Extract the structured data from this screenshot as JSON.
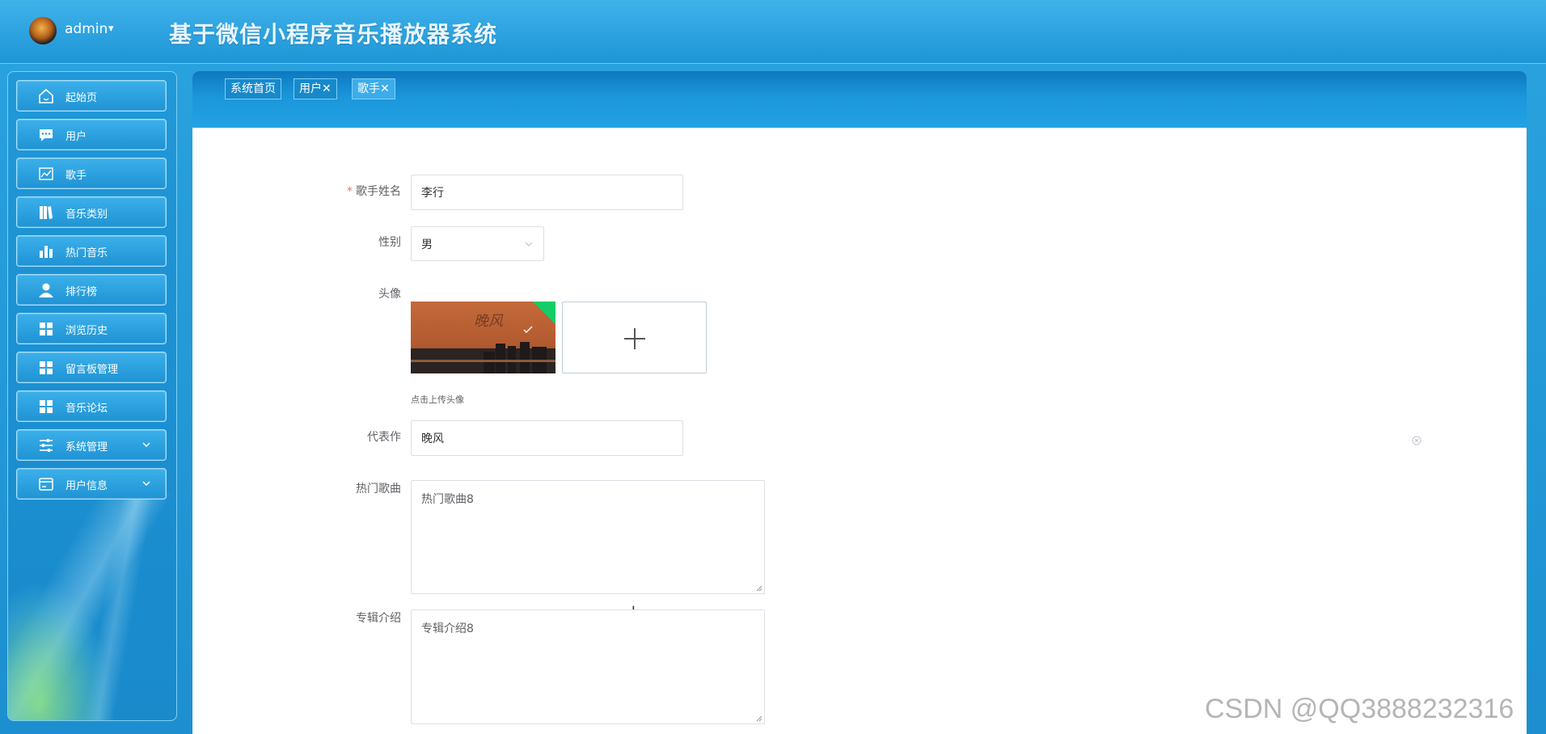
{
  "header": {
    "app_title": "基于微信小程序音乐播放器系统",
    "user": "admin",
    "user_caret": "▾"
  },
  "sidebar": {
    "items": [
      {
        "label": "起始页",
        "icon": "home-icon"
      },
      {
        "label": "用户",
        "icon": "chat-icon"
      },
      {
        "label": "歌手",
        "icon": "trend-chart-icon"
      },
      {
        "label": "音乐类别",
        "icon": "books-icon"
      },
      {
        "label": "热门音乐",
        "icon": "bar-chart-icon"
      },
      {
        "label": "排行榜",
        "icon": "person-icon"
      },
      {
        "label": "浏览历史",
        "icon": "grid-icon"
      },
      {
        "label": "留言板管理",
        "icon": "grid-icon"
      },
      {
        "label": "音乐论坛",
        "icon": "grid-icon"
      },
      {
        "label": "系统管理",
        "icon": "sliders-icon",
        "expandable": true
      },
      {
        "label": "用户信息",
        "icon": "card-icon",
        "expandable": true
      }
    ]
  },
  "tabs": [
    {
      "label": "系统首页",
      "closable": false,
      "active": false
    },
    {
      "label": "用户",
      "closable": true,
      "active": false
    },
    {
      "label": "歌手",
      "closable": true,
      "active": true
    }
  ],
  "tab_close_glyph": "✕",
  "form": {
    "singer_name": {
      "label": "歌手姓名",
      "value": "李行",
      "required_mark": "*"
    },
    "gender": {
      "label": "性别",
      "value": "男"
    },
    "avatar": {
      "label": "头像",
      "tip": "点击上传头像",
      "thumb_text": "晚风"
    },
    "masterpiece": {
      "label": "代表作",
      "value": "晚风"
    },
    "hot_songs": {
      "label": "热门歌曲",
      "value": "热门歌曲8"
    },
    "album_intro": {
      "label": "专辑介绍",
      "value": "专辑介绍8"
    }
  },
  "watermark": "CSDN @QQ3888232316",
  "colors": {
    "primary_blue": "#1d95d6",
    "required_red": "#f56c6c",
    "upload_success_green": "#13ce66"
  }
}
